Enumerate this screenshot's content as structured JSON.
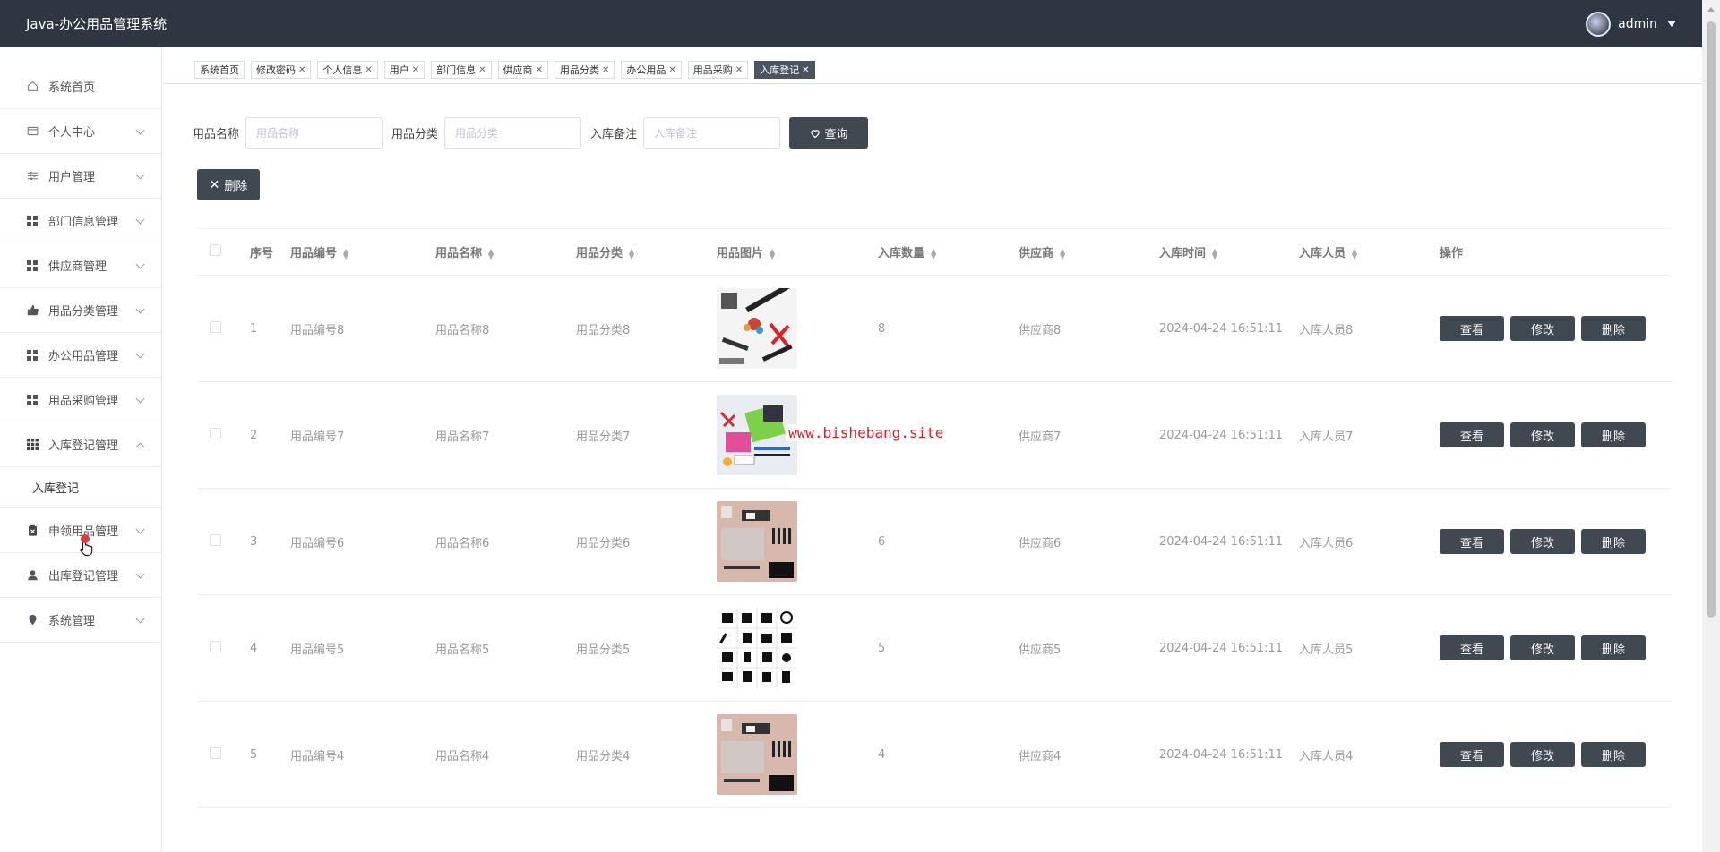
{
  "header": {
    "title": "Java-办公用品管理系统",
    "user": "admin"
  },
  "sidebar": {
    "items": [
      {
        "label": "系统首页",
        "icon": "home-icon",
        "expandable": false
      },
      {
        "label": "个人中心",
        "icon": "card-icon",
        "expandable": true
      },
      {
        "label": "用户管理",
        "icon": "sliders-icon",
        "expandable": true
      },
      {
        "label": "部门信息管理",
        "icon": "grid-icon",
        "expandable": true
      },
      {
        "label": "供应商管理",
        "icon": "grid-icon",
        "expandable": true
      },
      {
        "label": "用品分类管理",
        "icon": "thumb-up-icon",
        "expandable": true
      },
      {
        "label": "办公用品管理",
        "icon": "grid-icon",
        "expandable": true
      },
      {
        "label": "用品采购管理",
        "icon": "grid-icon",
        "expandable": true
      },
      {
        "label": "入库登记管理",
        "icon": "apps-icon",
        "expandable": true,
        "expanded": true
      },
      {
        "label": "申领用品管理",
        "icon": "clipboard-icon",
        "expandable": true
      },
      {
        "label": "出库登记管理",
        "icon": "user-icon",
        "expandable": true
      },
      {
        "label": "系统管理",
        "icon": "pin-icon",
        "expandable": true
      }
    ],
    "submenu": {
      "label": "入库登记"
    }
  },
  "tabs": [
    {
      "label": "系统首页",
      "closable": false
    },
    {
      "label": "修改密码",
      "closable": true
    },
    {
      "label": "个人信息",
      "closable": true
    },
    {
      "label": "用户",
      "closable": true
    },
    {
      "label": "部门信息",
      "closable": true
    },
    {
      "label": "供应商",
      "closable": true
    },
    {
      "label": "用品分类",
      "closable": true
    },
    {
      "label": "办公用品",
      "closable": true
    },
    {
      "label": "用品采购",
      "closable": true
    },
    {
      "label": "入库登记",
      "closable": true,
      "active": true
    }
  ],
  "search": {
    "name_label": "用品名称",
    "name_placeholder": "用品名称",
    "category_label": "用品分类",
    "category_placeholder": "用品分类",
    "remark_label": "入库备注",
    "remark_placeholder": "入库备注",
    "query_label": "查询"
  },
  "delete_label": "删除",
  "table": {
    "headers": [
      "序号",
      "用品编号",
      "用品名称",
      "用品分类",
      "用品图片",
      "入库数量",
      "供应商",
      "入库时间",
      "入库人员",
      "操作"
    ],
    "rows": [
      {
        "idx": "1",
        "code": "用品编号8",
        "name": "用品名称8",
        "category": "用品分类8",
        "qty": "8",
        "supplier": "供应商8",
        "time": "2024-04-24 16:51:11",
        "person": "入库人员8",
        "img": "stationery-flatlay"
      },
      {
        "idx": "2",
        "code": "用品编号7",
        "name": "用品名称7",
        "category": "用品分类7",
        "qty": "7",
        "supplier": "供应商7",
        "time": "2024-04-24 16:51:11",
        "person": "入库人员7",
        "img": "colorful-supplies"
      },
      {
        "idx": "3",
        "code": "用品编号6",
        "name": "用品名称6",
        "category": "用品分类6",
        "qty": "6",
        "supplier": "供应商6",
        "time": "2024-04-24 16:51:11",
        "person": "入库人员6",
        "img": "pink-desk"
      },
      {
        "idx": "4",
        "code": "用品编号5",
        "name": "用品名称5",
        "category": "用品分类5",
        "qty": "5",
        "supplier": "供应商5",
        "time": "2024-04-24 16:51:11",
        "person": "入库人员5",
        "img": "icon-grid"
      },
      {
        "idx": "5",
        "code": "用品编号4",
        "name": "用品名称4",
        "category": "用品分类4",
        "qty": "4",
        "supplier": "供应商4",
        "time": "2024-04-24 16:51:11",
        "person": "入库人员4",
        "img": "pink-desk"
      }
    ],
    "actions": {
      "view": "查看",
      "edit": "修改",
      "delete": "删除"
    }
  },
  "watermark": "www.bishebang.site"
}
